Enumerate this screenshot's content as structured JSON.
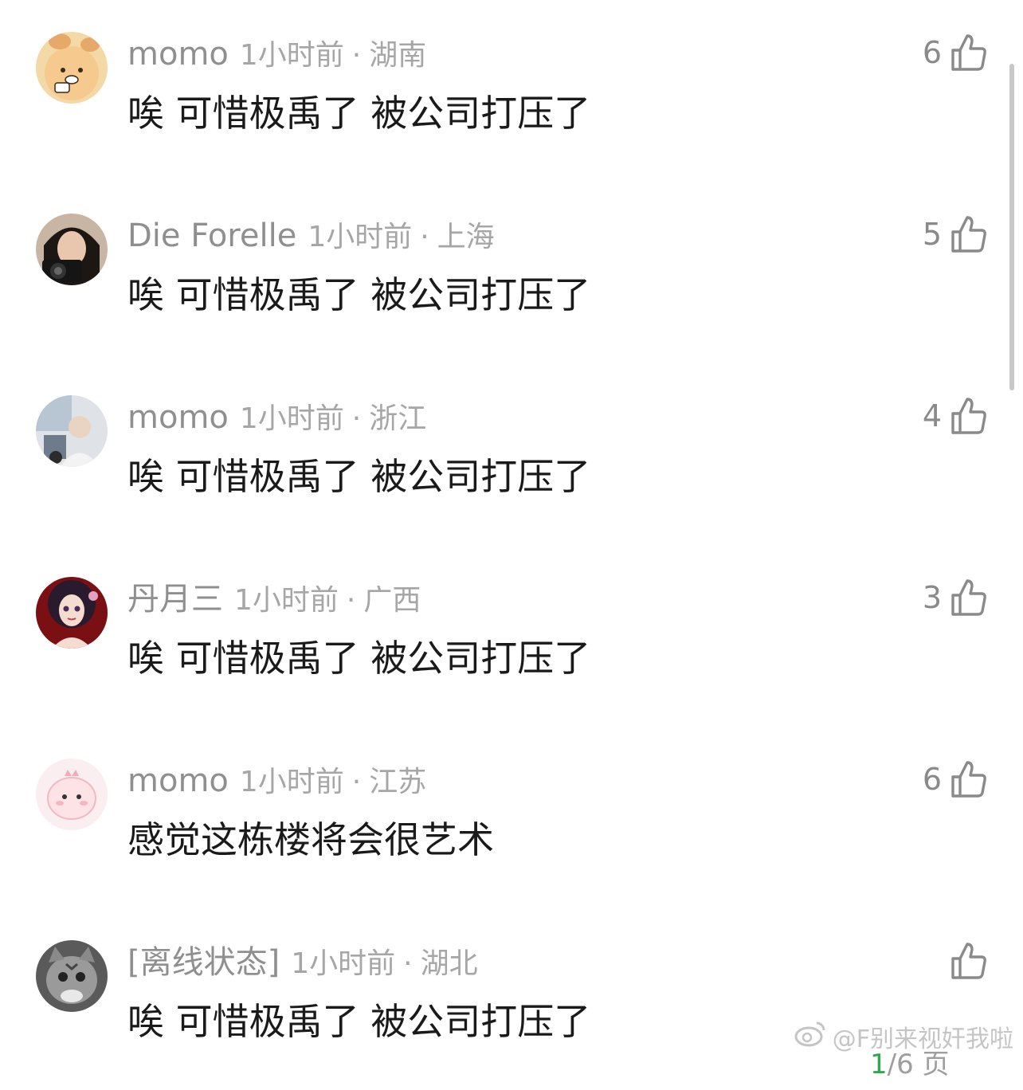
{
  "comments": [
    {
      "username": "momo",
      "time": "1小时前",
      "location": "湖南",
      "text": "唉 可惜极禹了 被公司打压了",
      "likes": "6",
      "avatar": "bear-avatar"
    },
    {
      "username": "Die Forelle",
      "time": "1小时前",
      "location": "上海",
      "text": "唉 可惜极禹了 被公司打压了",
      "likes": "5",
      "avatar": "girl-camera-avatar"
    },
    {
      "username": "momo",
      "time": "1小时前",
      "location": "浙江",
      "text": "唉 可惜极禹了 被公司打压了",
      "likes": "4",
      "avatar": "photo-avatar"
    },
    {
      "username": "丹月三",
      "time": "1小时前",
      "location": "广西",
      "text": "唉 可惜极禹了 被公司打压了",
      "likes": "3",
      "avatar": "doll-avatar"
    },
    {
      "username": "momo",
      "time": "1小时前",
      "location": "江苏",
      "text": "感觉这栋楼将会很艺术",
      "likes": "6",
      "avatar": "pink-dino-avatar"
    },
    {
      "username": "[离线状态]",
      "time": "1小时前",
      "location": "湖北",
      "text": "唉 可惜极禹了 被公司打压了",
      "likes": "",
      "avatar": "cat-avatar"
    }
  ],
  "separator": "·",
  "watermark": {
    "text": "@F别来视奸我啦",
    "icon": "weibo-icon"
  },
  "page_indicator": {
    "current": "1",
    "rest": "/6 页"
  },
  "colors": {
    "meta": "#9b9b9b",
    "body": "#1a1a1a",
    "page_current": "#2fa84f"
  }
}
